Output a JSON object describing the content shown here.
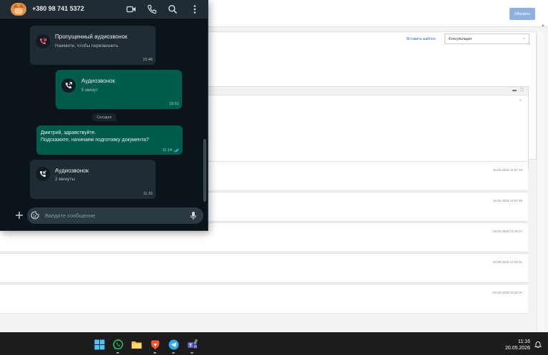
{
  "crm": {
    "update_button": "Обновить",
    "insert_template_link": "Вставить шаблон",
    "template_select_value": "Консультация",
    "rows": [
      {
        "date": "18.05.2026 15:57:18"
      },
      {
        "date": "18.05.2026 15:57:08"
      },
      {
        "date": "18.05.2026 14:39:27"
      },
      {
        "date": "20.08.2025 10:54:21"
      },
      {
        "date": "20.08.2025 10:52:31"
      }
    ]
  },
  "whatsapp": {
    "contact_phone": "+380 98 741 5372",
    "messages": [
      {
        "kind": "missed-call",
        "title": "Пропущенный аудиозвонок",
        "subtitle": "Нажмите, чтобы перезвонить",
        "time": "15:46"
      },
      {
        "kind": "outgoing-call",
        "title": "Аудиозвонок",
        "subtitle": "5 минут",
        "time": "15:51"
      },
      {
        "kind": "date-divider",
        "label": "Сегодня"
      },
      {
        "kind": "outgoing-text",
        "line1": "Дмитрий, здравствуйте.",
        "line2": "Подскажите, начинаем подготовку документа?",
        "time": "11:14"
      },
      {
        "kind": "incoming-call",
        "title": "Аудиозвонок",
        "subtitle": "2 минуты",
        "time": "11:16"
      }
    ],
    "compose_placeholder": "Введите сообщение",
    "colors": {
      "outgoing_bubble": "#005c4b",
      "incoming_bubble": "#202c33",
      "background": "#0b141a",
      "missed_call_red": "#f15c6d"
    }
  },
  "taskbar": {
    "apps": [
      "windows-start",
      "whatsapp",
      "file-explorer",
      "brave-browser",
      "telegram",
      "teams"
    ],
    "time": "11:16",
    "date": "20.05.2026"
  }
}
